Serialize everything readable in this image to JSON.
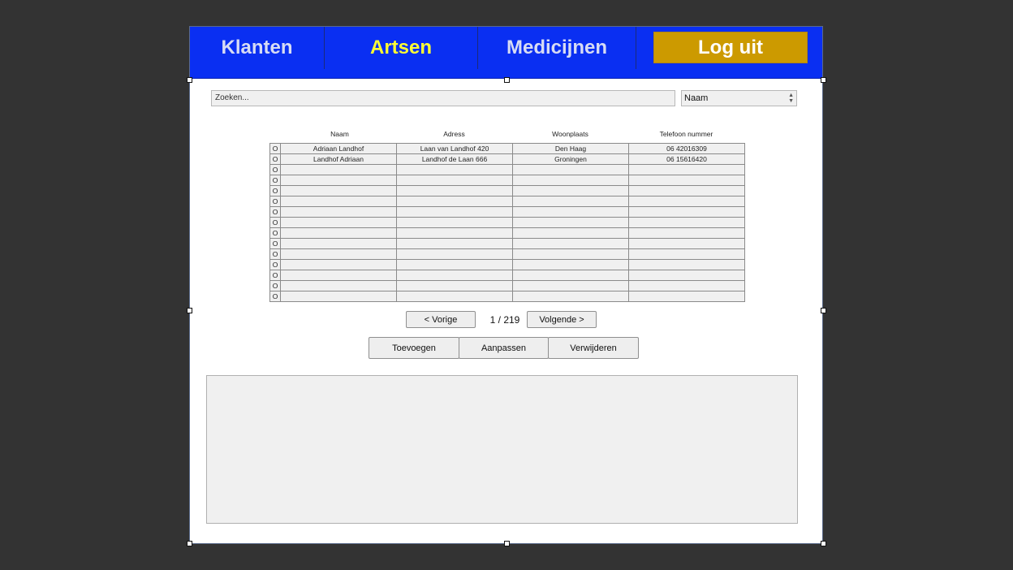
{
  "nav": {
    "tabs": [
      {
        "label": "Klanten",
        "active": false
      },
      {
        "label": "Artsen",
        "active": true
      },
      {
        "label": "Medicijnen",
        "active": false
      }
    ],
    "logout_label": "Log uit"
  },
  "search": {
    "placeholder": "Zoeken...",
    "field_select": "Naam"
  },
  "table": {
    "columns": [
      "Naam",
      "Adress",
      "Woonplaats",
      "Telefoon nummer"
    ],
    "radio_glyph": "O",
    "rows": [
      [
        "Adriaan Landhof",
        "Laan van Landhof 420",
        "Den Haag",
        "06 42016309"
      ],
      [
        "Landhof Adriaan",
        "Landhof de Laan 666",
        "Groningen",
        "06 15616420"
      ],
      [
        "",
        "",
        "",
        ""
      ],
      [
        "",
        "",
        "",
        ""
      ],
      [
        "",
        "",
        "",
        ""
      ],
      [
        "",
        "",
        "",
        ""
      ],
      [
        "",
        "",
        "",
        ""
      ],
      [
        "",
        "",
        "",
        ""
      ],
      [
        "",
        "",
        "",
        ""
      ],
      [
        "",
        "",
        "",
        ""
      ],
      [
        "",
        "",
        "",
        ""
      ],
      [
        "",
        "",
        "",
        ""
      ],
      [
        "",
        "",
        "",
        ""
      ],
      [
        "",
        "",
        "",
        ""
      ],
      [
        "",
        "",
        "",
        ""
      ]
    ]
  },
  "pager": {
    "prev_label": "< Vorige",
    "page_info": "1 / 219",
    "next_label": "Volgende >"
  },
  "actions": {
    "add_label": "Toevoegen",
    "edit_label": "Aanpassen",
    "delete_label": "Verwijderen"
  },
  "colors": {
    "nav_bg": "#0a2ff2",
    "nav_active_text": "#ffff33",
    "logout_bg": "#cc9a00",
    "page_bg": "#333333"
  }
}
